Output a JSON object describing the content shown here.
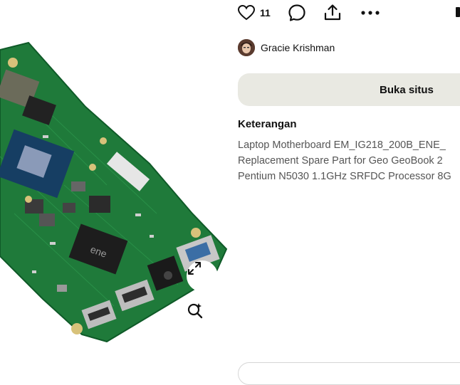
{
  "actions": {
    "like_count": "11",
    "icons": [
      "heart-icon",
      "comment-icon",
      "share-icon",
      "more-icon"
    ]
  },
  "author": {
    "name": "Gracie Krishman"
  },
  "open_button_label": "Buka situs",
  "description": {
    "heading": "Keterangan",
    "lines": [
      "Laptop Motherboard EM_IG218_200B_ENE_",
      "Replacement Spare Part for Geo GeoBook 2",
      "Pentium N5030 1.1GHz SRFDC Processor 8G"
    ]
  },
  "colors": {
    "button_bg": "#e9e9e2",
    "board_green": "#1f7a3a",
    "text_secondary": "#555555"
  }
}
